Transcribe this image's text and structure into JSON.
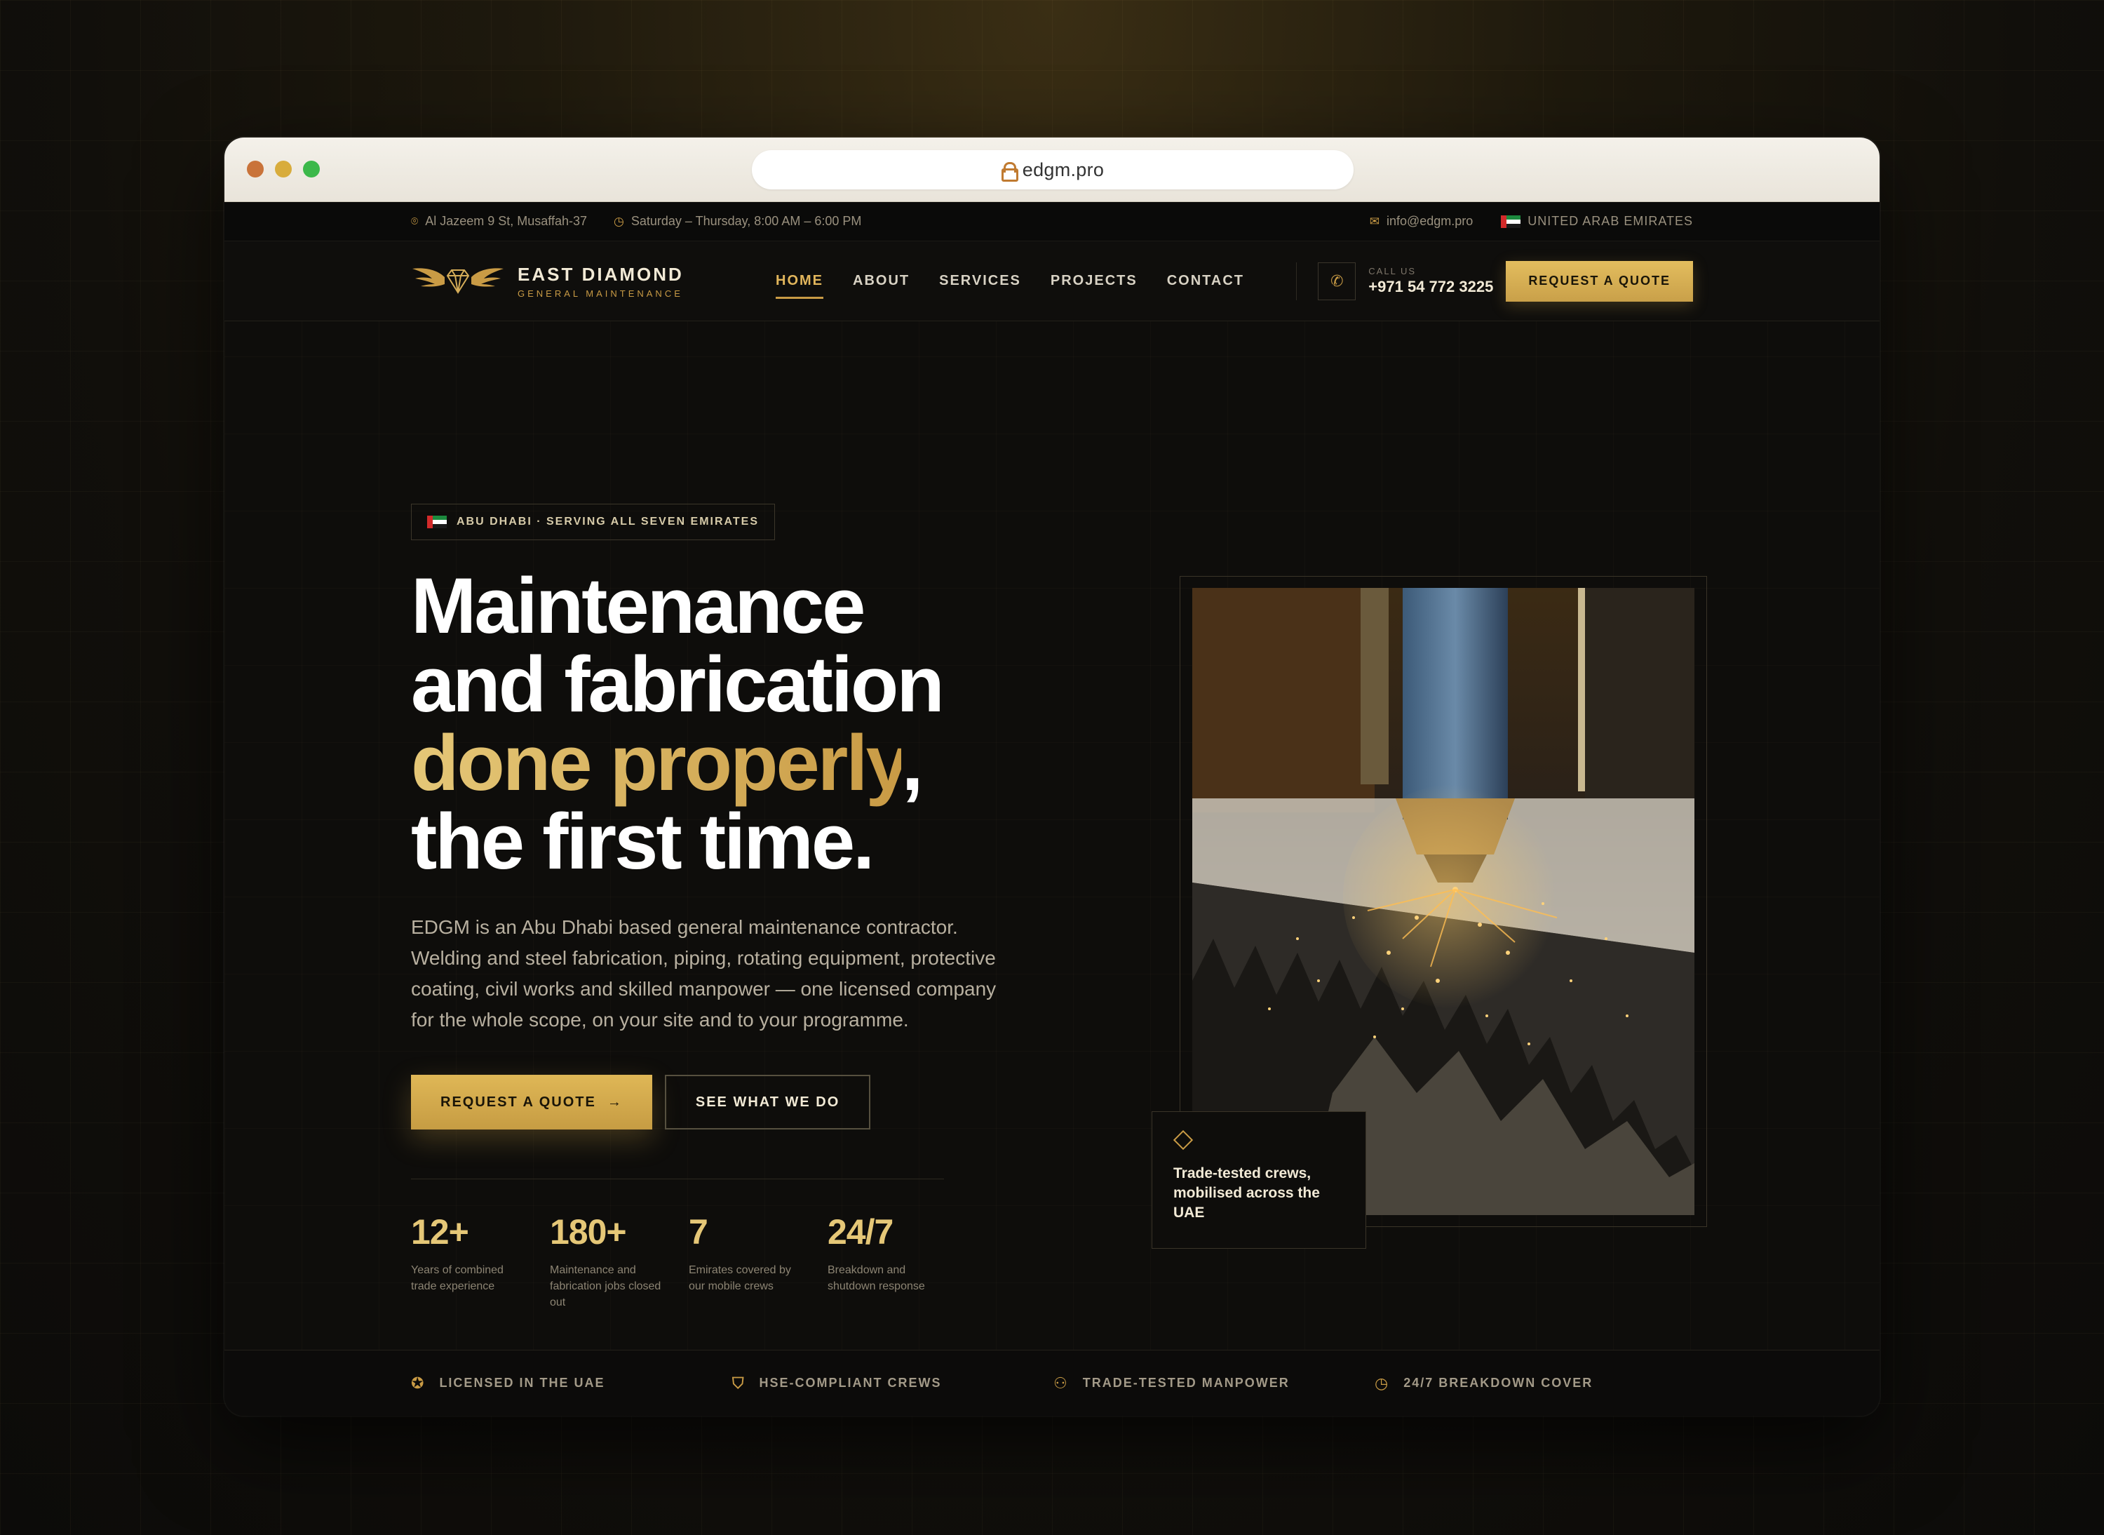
{
  "browser": {
    "url": "edgm.pro"
  },
  "topbar": {
    "address": "Al Jazeem 9 St, Musaffah-37",
    "hours": "Saturday – Thursday, 8:00 AM – 6:00 PM",
    "email": "info@edgm.pro",
    "country": "UNITED ARAB EMIRATES"
  },
  "nav": {
    "logo_title": "EAST DIAMOND",
    "logo_subtitle": "GENERAL MAINTENANCE",
    "items": [
      {
        "label": "HOME"
      },
      {
        "label": "ABOUT"
      },
      {
        "label": "SERVICES"
      },
      {
        "label": "PROJECTS"
      },
      {
        "label": "CONTACT"
      }
    ],
    "call_label": "CALL US",
    "phone": "+971 54 772 3225",
    "quote_button": "REQUEST A QUOTE"
  },
  "hero": {
    "badge": "ABU DHABI · SERVING ALL SEVEN EMIRATES",
    "headline_line1": "Maintenance",
    "headline_line2": "and fabrication",
    "headline_gold": "done properly",
    "headline_comma": ",",
    "headline_line4": "the first time.",
    "lede": "EDGM is an Abu Dhabi based general maintenance contractor. Welding and steel fabrication, piping, rotating equipment, protective coating, civil works and skilled manpower — one licensed company for the whole scope, on your site and to your programme.",
    "cta_primary": "REQUEST A QUOTE",
    "cta_secondary": "SEE WHAT WE DO",
    "stats": [
      {
        "value": "12+",
        "desc": "Years of combined trade experience"
      },
      {
        "value": "180+",
        "desc": "Maintenance and fabrication jobs closed out"
      },
      {
        "value": "7",
        "desc": "Emirates covered by our mobile crews"
      },
      {
        "value": "24/7",
        "desc": "Breakdown and shutdown response"
      }
    ],
    "caption": "Trade-tested crews, mobilised across the UAE"
  },
  "strip": [
    {
      "label": "LICENSED IN THE UAE",
      "icon": "award-icon"
    },
    {
      "label": "HSE-COMPLIANT CREWS",
      "icon": "shield-check-icon"
    },
    {
      "label": "TRADE-TESTED MANPOWER",
      "icon": "users-icon"
    },
    {
      "label": "24/7 BREAKDOWN COVER",
      "icon": "clock-icon"
    }
  ],
  "colors": {
    "gold": "#c99b45",
    "gold_light": "#e5c777",
    "bg": "#0e0d0b"
  }
}
